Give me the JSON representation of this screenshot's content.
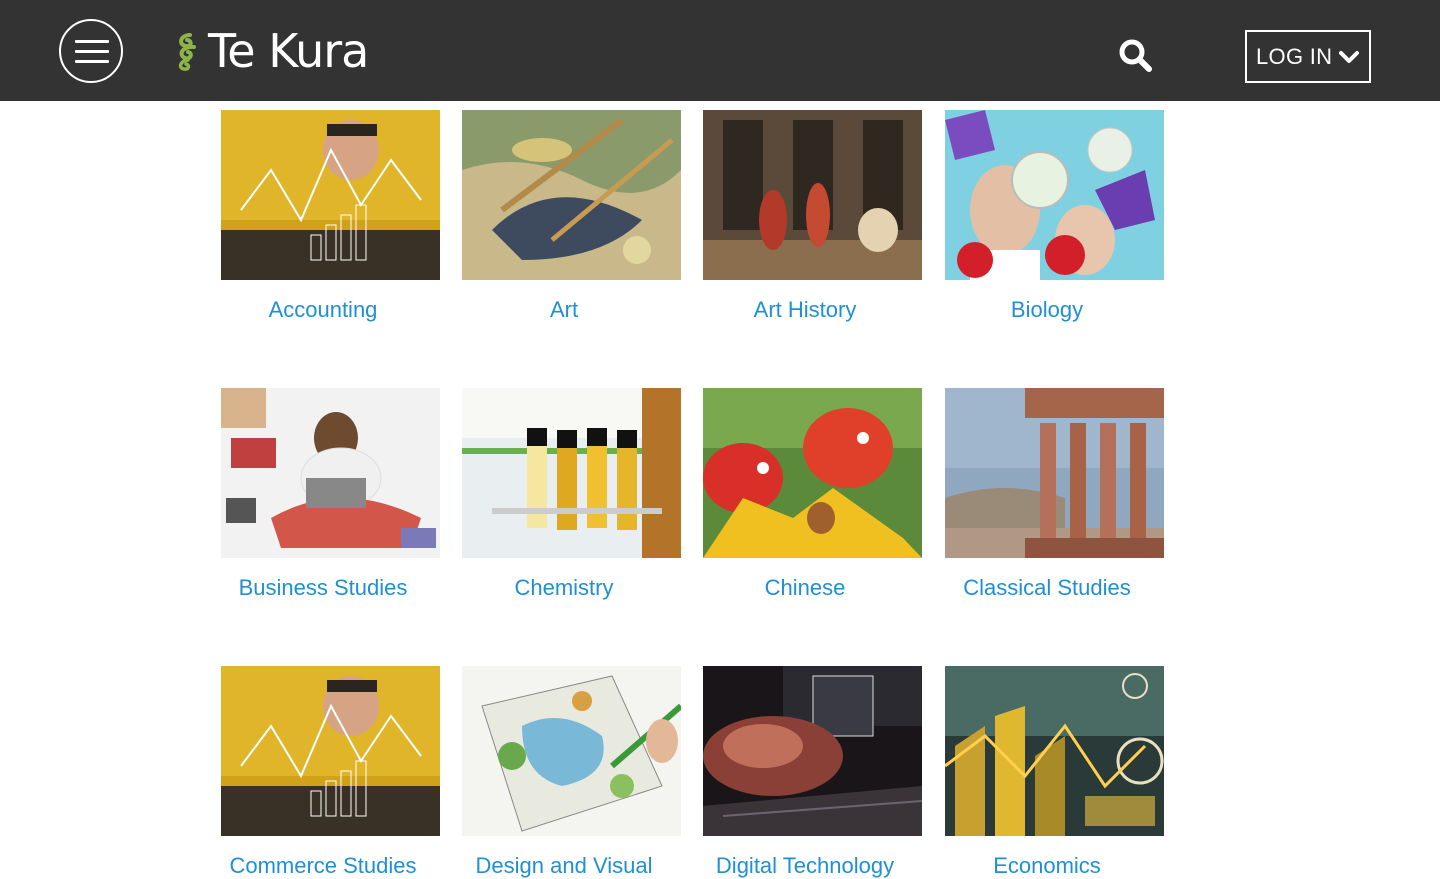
{
  "header": {
    "logo_text": "Te Kura",
    "login_label": "LOG IN",
    "bar_color": "#333333",
    "icons": {
      "menu": "hamburger-menu-icon",
      "search": "search-icon",
      "login": "chevron-down-icon",
      "logo": "koru-logo-icon"
    }
  },
  "subjects": [
    {
      "label": "Accounting"
    },
    {
      "label": "Art"
    },
    {
      "label": "Art History"
    },
    {
      "label": "Biology"
    },
    {
      "label": "Business Studies"
    },
    {
      "label": "Chemistry"
    },
    {
      "label": "Chinese"
    },
    {
      "label": "Classical Studies"
    },
    {
      "label": "Commerce Studies"
    },
    {
      "label": "Design and Visual"
    },
    {
      "label": "Digital Technology"
    },
    {
      "label": "Economics"
    }
  ],
  "colors": {
    "link": "#1f8fd6",
    "logo_accent": "#8db44a"
  }
}
